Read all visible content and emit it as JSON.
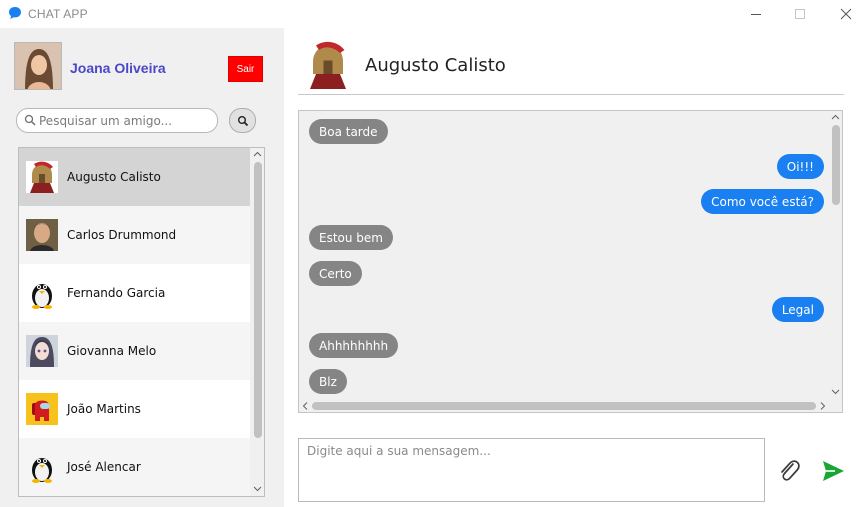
{
  "app": {
    "title": "CHAT APP",
    "accent_color": "#1a7ff0",
    "logout_color": "#ff0000"
  },
  "window_controls": {
    "minimize_icon": "minimize-icon",
    "maximize_icon": "maximize-icon",
    "close_icon": "close-icon"
  },
  "user": {
    "name": "Joana Oliveira",
    "logout_label": "Sair"
  },
  "search": {
    "placeholder": "Pesquisar um amigo...",
    "value": ""
  },
  "friends": [
    {
      "name": "Augusto Calisto",
      "avatar": "spartan-warrior-avatar",
      "selected": true
    },
    {
      "name": "Carlos Drummond",
      "avatar": "man-photo-avatar",
      "selected": false
    },
    {
      "name": "Fernando Garcia",
      "avatar": "penguin-avatar",
      "selected": false
    },
    {
      "name": "Giovanna Melo",
      "avatar": "anime-girl-avatar",
      "selected": false
    },
    {
      "name": "João Martins",
      "avatar": "among-us-avatar",
      "selected": false
    },
    {
      "name": "José Alencar",
      "avatar": "penguin-avatar",
      "selected": false
    }
  ],
  "conversation": {
    "contact_name": "Augusto Calisto",
    "messages": [
      {
        "text": "Boa tarde",
        "direction": "in"
      },
      {
        "text": "Oi!!!",
        "direction": "out"
      },
      {
        "text": "Como você está?",
        "direction": "out"
      },
      {
        "text": "Estou bem",
        "direction": "in"
      },
      {
        "text": "Certo",
        "direction": "in"
      },
      {
        "text": "Legal",
        "direction": "out"
      },
      {
        "text": "Ahhhhhhhh",
        "direction": "in"
      },
      {
        "text": "Blz",
        "direction": "in"
      }
    ]
  },
  "composer": {
    "placeholder": "Digite aqui a sua mensagem...",
    "value": "",
    "attach_icon": "paperclip-icon",
    "send_icon": "send-icon"
  }
}
